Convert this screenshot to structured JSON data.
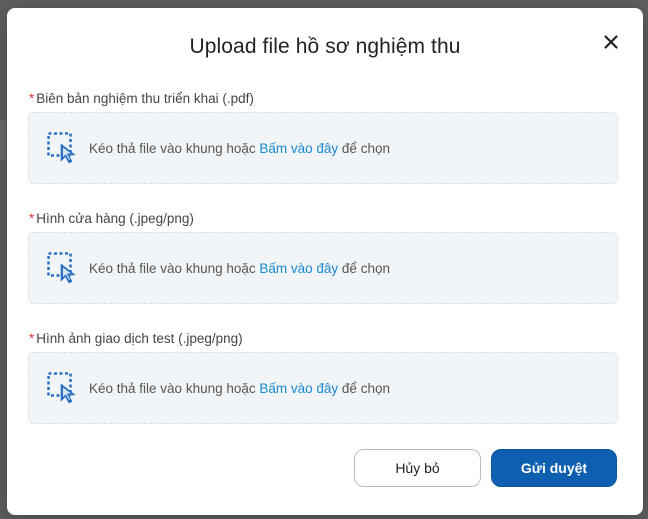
{
  "modal": {
    "title": "Upload file hồ sơ nghiệm thu",
    "close_icon": "close-icon"
  },
  "fields": [
    {
      "required_mark": "*",
      "label": "Biên bản nghiệm thu triển khai (.pdf)",
      "drop_text_before": "Kéo thả file vào khung hoặc ",
      "drop_link": "Bấm vào đây",
      "drop_text_after": " để chọn"
    },
    {
      "required_mark": "*",
      "label": "Hình cửa hàng (.jpeg/png)",
      "drop_text_before": "Kéo thả file vào khung hoặc ",
      "drop_link": "Bấm vào đây",
      "drop_text_after": " để chọn"
    },
    {
      "required_mark": "*",
      "label": "Hình ảnh giao dịch test (.jpeg/png)",
      "drop_text_before": "Kéo thả file vào khung hoặc ",
      "drop_link": "Bấm vào đây",
      "drop_text_after": " để chọn"
    }
  ],
  "actions": {
    "cancel_label": "Hủy bỏ",
    "submit_label": "Gửi duyệt"
  },
  "colors": {
    "primary": "#0f5fb0",
    "link": "#1a8ad0",
    "required": "#e53935",
    "dropzone_bg": "#f2f5f8"
  }
}
